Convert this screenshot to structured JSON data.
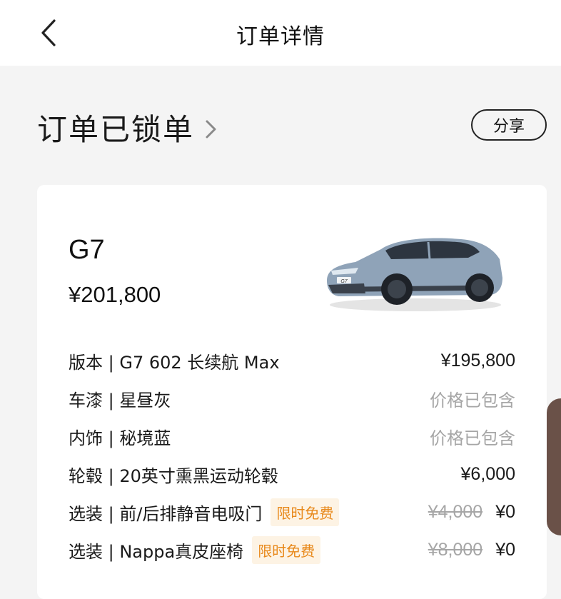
{
  "nav": {
    "title": "订单详情"
  },
  "status": {
    "text": "订单已锁单",
    "share_label": "分享"
  },
  "vehicle": {
    "model": "G7",
    "price": "¥201,800",
    "badge": "G7"
  },
  "config_rows": [
    {
      "label": "版本 | G7 602 长续航 Max",
      "value": "¥195,800"
    },
    {
      "label": "车漆 | 星昼灰",
      "value": "价格已包含"
    },
    {
      "label": "内饰 | 秘境蓝",
      "value": "价格已包含"
    },
    {
      "label": "轮毂 | 20英寸熏黑运动轮毂",
      "value": "¥6,000"
    },
    {
      "label": "选装 | 前/后排静音电吸门",
      "tag": "限时免费",
      "original": "¥4,000",
      "value": "¥0"
    },
    {
      "label": "选装 | Nappa真皮座椅",
      "tag": "限时免费",
      "original": "¥8,000",
      "value": "¥0"
    }
  ],
  "colors": {
    "page_bg": "#f4f4f4",
    "card_bg": "#ffffff",
    "tag_text": "#e8891b",
    "tag_bg": "#fdf3e4",
    "muted_text": "#a6a6a6",
    "car_body": "#8fa3b8",
    "side_tab": "#6a5148"
  },
  "icons": {
    "back": "chevron-left-icon",
    "status_arrow": "chevron-right-icon"
  }
}
